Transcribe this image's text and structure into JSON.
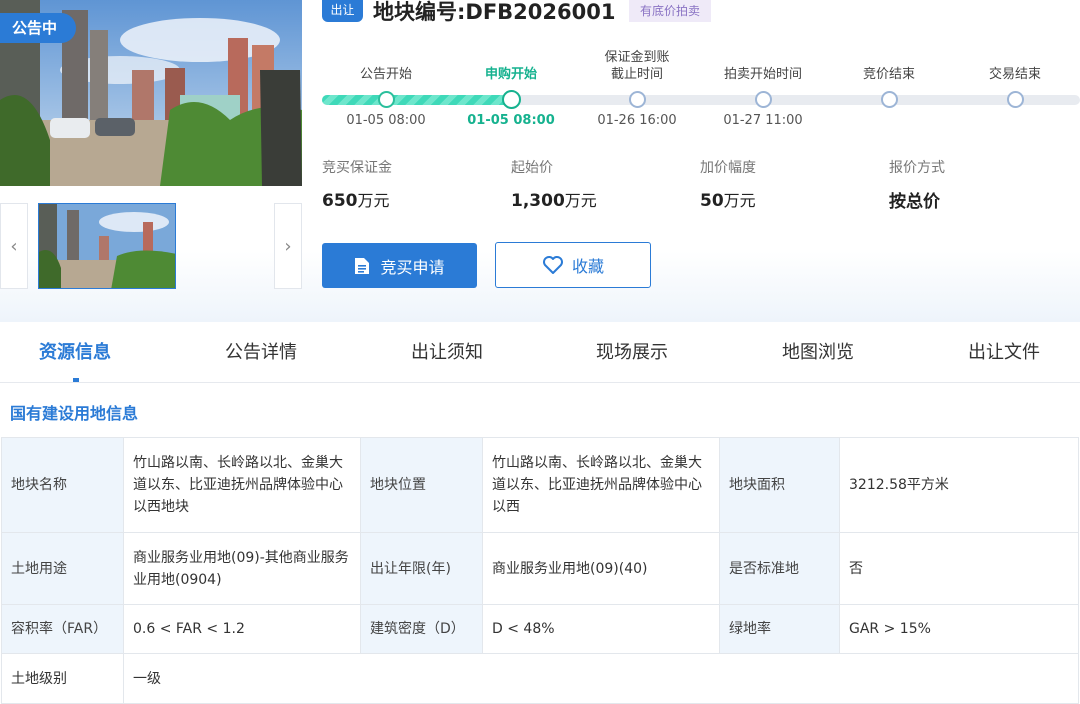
{
  "header": {
    "status_tag": "公告中",
    "badge": "出让",
    "lot_title": "地块编号:DFB2026001",
    "reserve_tag": "有底价拍卖"
  },
  "gallery": {
    "prev_icon": "‹",
    "next_icon": "›"
  },
  "timeline": {
    "progress_fraction": 0.25,
    "steps": [
      {
        "label": "公告开始",
        "time": "01-05 08:00",
        "state": "done"
      },
      {
        "label": "申购开始",
        "time": "01-05 08:00",
        "state": "active"
      },
      {
        "label": "保证金到账\n截止时间",
        "time": "01-26 16:00",
        "state": "pending"
      },
      {
        "label": "拍卖开始时间",
        "time": "01-27 11:00",
        "state": "pending"
      },
      {
        "label": "竞价结束",
        "time": "",
        "state": "pending"
      },
      {
        "label": "交易结束",
        "time": "",
        "state": "pending"
      }
    ]
  },
  "stats": [
    {
      "label": "竞买保证金",
      "value": "650",
      "unit": "万元"
    },
    {
      "label": "起始价",
      "value": "1,300",
      "unit": "万元"
    },
    {
      "label": "加价幅度",
      "value": "50",
      "unit": "万元"
    },
    {
      "label": "报价方式",
      "value": "按总价",
      "unit": ""
    }
  ],
  "actions": {
    "apply": "竞买申请",
    "favorite": "收藏"
  },
  "tabs": [
    "资源信息",
    "公告详情",
    "出让须知",
    "现场展示",
    "地图浏览",
    "出让文件"
  ],
  "section_title": "国有建设用地信息",
  "land_info": {
    "name_label": "地块名称",
    "name_value": "竹山路以南、长岭路以北、金巢大道以东、比亚迪抚州品牌体验中心以西地块",
    "location_label": "地块位置",
    "location_value": "竹山路以南、长岭路以北、金巢大道以东、比亚迪抚州品牌体验中心以西",
    "area_label": "地块面积",
    "area_value": "3212.58平方米",
    "use_label": "土地用途",
    "use_value": "商业服务业用地(09)-其他商业服务业用地(0904)",
    "term_label": "出让年限(年)",
    "term_value": "商业服务业用地(09)(40)",
    "standard_label": "是否标准地",
    "standard_value": "否",
    "far_label": "容积率（FAR）",
    "far_value": "0.6 < FAR < 1.2",
    "density_label": "建筑密度（D）",
    "density_value": "D < 48%",
    "green_label": "绿地率",
    "green_value": "GAR > 15%",
    "grade_label": "土地级别",
    "grade_value": "一级"
  },
  "colors": {
    "primary": "#2b7bd6",
    "success": "#16b28f",
    "table_key_bg": "#eef5fc"
  }
}
